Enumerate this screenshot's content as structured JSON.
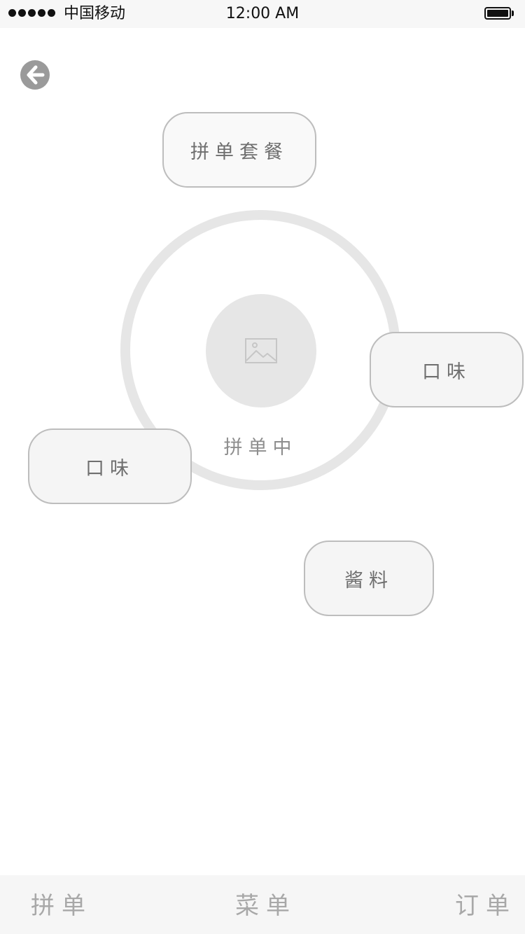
{
  "status_bar": {
    "carrier": "中国移动",
    "time": "12:00 AM",
    "signal_icon": "signal-dots-icon",
    "battery_icon": "battery-full-icon"
  },
  "header": {
    "back_icon": "arrow-left-circle-icon"
  },
  "main": {
    "options": {
      "combo": "拼单套餐",
      "taste_right": "口味",
      "taste_left": "口味",
      "sauce": "酱料"
    },
    "center": {
      "image_icon": "image-placeholder-icon",
      "status": "拼单中"
    }
  },
  "tab_bar": {
    "items": [
      {
        "label": "拼单"
      },
      {
        "label": "菜单"
      },
      {
        "label": "订单"
      }
    ]
  },
  "colors": {
    "ring": "#e6e6e6",
    "pill_border": "#bdbdbd",
    "pill_bg": "#f5f5f5",
    "text_gray": "#6f6f6f",
    "tab_text": "#a8a8a8"
  }
}
